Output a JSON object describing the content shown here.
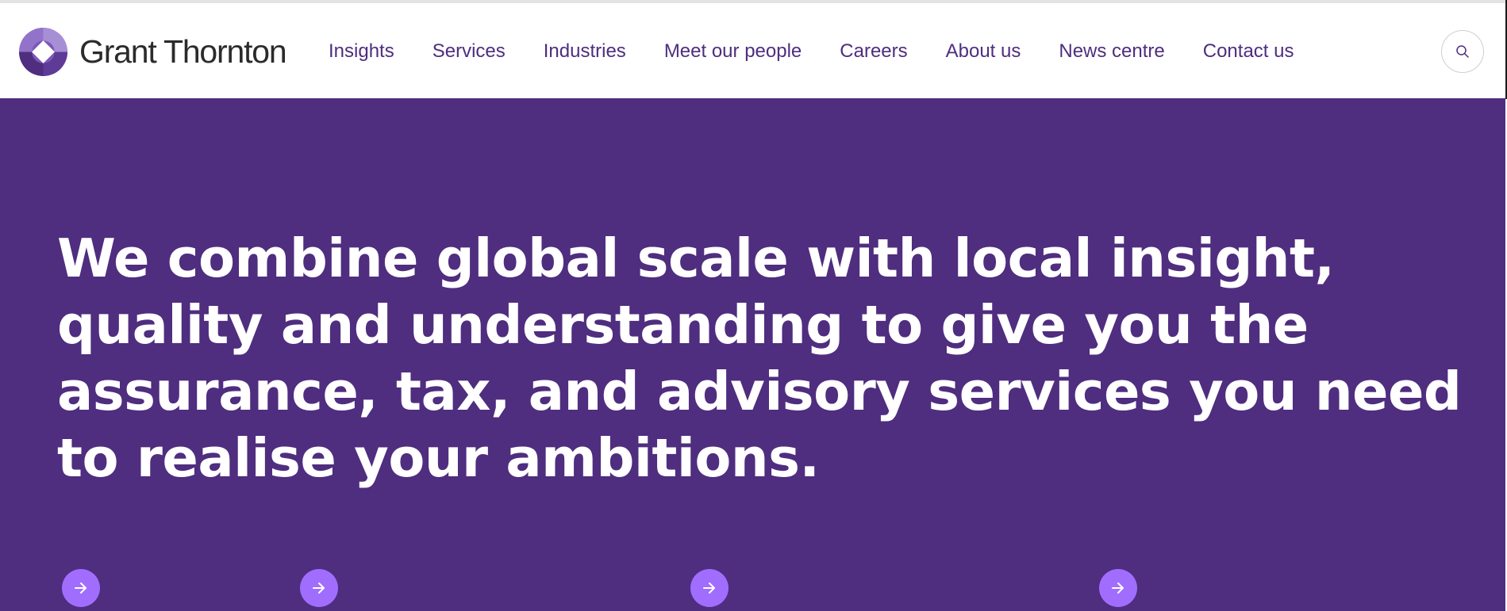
{
  "brand": {
    "name": "Grant Thornton",
    "logo_icon": "grant-thornton-swirl-icon",
    "accent_color": "#4f2d7f",
    "highlight_color": "#a06dff"
  },
  "nav": {
    "items": [
      {
        "label": "Insights"
      },
      {
        "label": "Services"
      },
      {
        "label": "Industries"
      },
      {
        "label": "Meet our people"
      },
      {
        "label": "Careers"
      },
      {
        "label": "About us"
      },
      {
        "label": "News centre"
      },
      {
        "label": "Contact us"
      }
    ],
    "search_icon": "search-icon"
  },
  "hero": {
    "headline": "We combine global scale with local insight, quality and understanding to give you the assurance, tax, and advisory services you need to realise your ambitions.",
    "background_color": "#4f2d7f",
    "cards": [
      {
        "icon": "arrow-right-icon"
      },
      {
        "icon": "arrow-right-icon"
      },
      {
        "icon": "arrow-right-icon"
      },
      {
        "icon": "arrow-right-icon"
      }
    ]
  }
}
